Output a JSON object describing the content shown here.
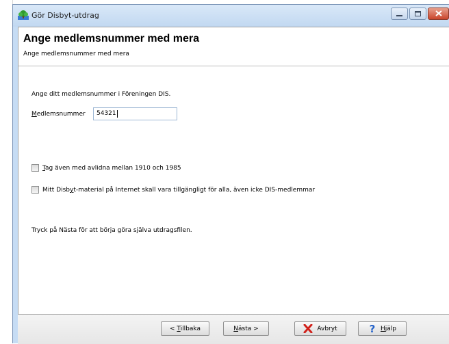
{
  "window": {
    "title": "Gör Disbyt-utdrag",
    "controls": {
      "minimize": "minimize",
      "maximize": "maximize",
      "close": "close"
    }
  },
  "header": {
    "title": "Ange medlemsnummer med mera",
    "subtitle": "Ange medlemsnummer med mera"
  },
  "form": {
    "intro": "Ange ditt medlemsnummer i Föreningen DIS.",
    "member_label_accel": "M",
    "member_label_rest": "edlemsnummer",
    "member_value": "54321",
    "checkbox1_accel": "T",
    "checkbox1_rest": "ag även med avlidna mellan 1910 och 1985",
    "checkbox1_checked": false,
    "checkbox2_before": "Mitt Disb",
    "checkbox2_accel": "y",
    "checkbox2_after": "t-material på Internet skall vara tillgängligt för alla, även icke DIS-medlemmar",
    "checkbox2_checked": false,
    "instruction": "Tryck på Nästa för att börja göra själva utdragsfilen."
  },
  "footer": {
    "back_prefix": "< ",
    "back_accel": "T",
    "back_rest": "illbaka",
    "next_accel": "N",
    "next_rest": "ästa >",
    "cancel": "Avbryt",
    "help_accel": "H",
    "help_rest": "jälp"
  },
  "icons": {
    "app": "tree-app-icon",
    "cancel": "red-x-icon",
    "help": "question-mark-icon"
  },
  "colors": {
    "title_bar": "#c6dcf4",
    "close_button": "#c9452c",
    "cancel_icon": "#d0201a",
    "help_icon": "#2563c9"
  }
}
